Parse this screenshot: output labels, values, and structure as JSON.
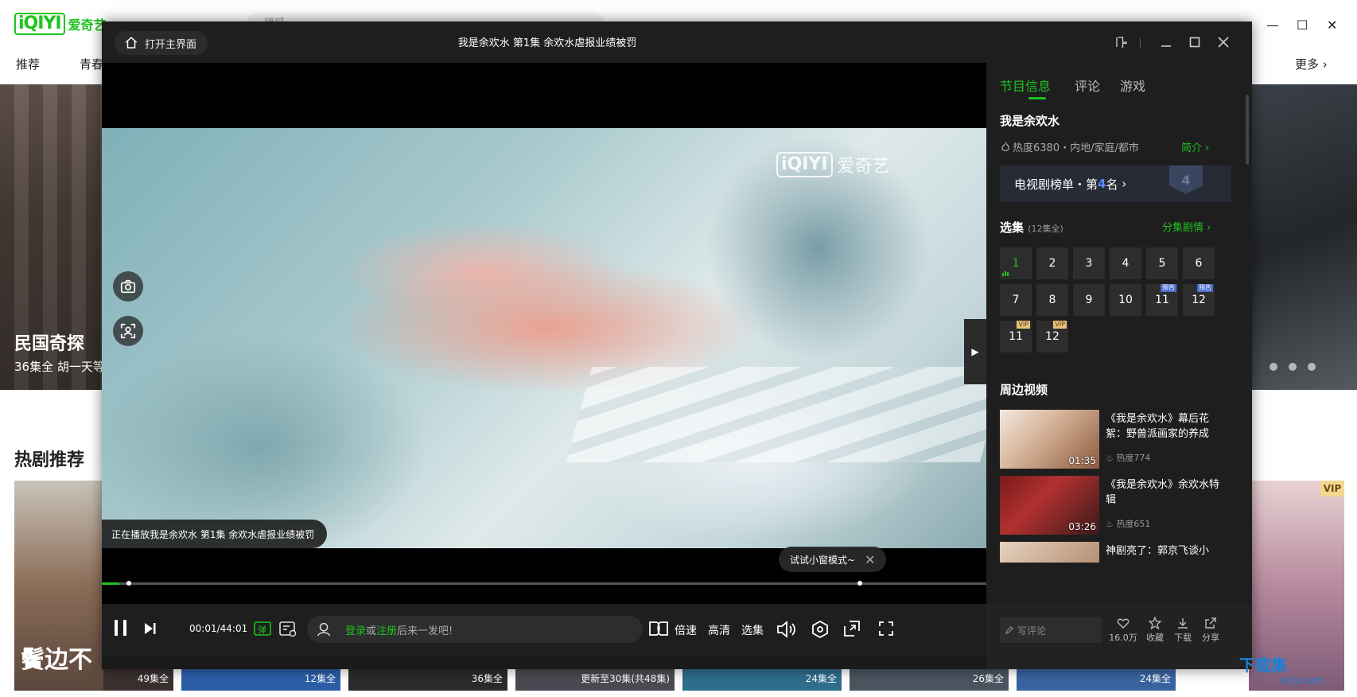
{
  "background": {
    "logo_mark": "iQIYI",
    "logo_text": "爱奇艺",
    "search_placeholder": "猎狐",
    "nav": [
      "推荐",
      "青春"
    ],
    "more": "更多",
    "banner_title": "民国奇探",
    "banner_sub": "36集全 胡一天等",
    "section_title": "热剧推荐",
    "vip_label": "VIP",
    "card_counts": [
      "49集全",
      "12集全",
      "36集全",
      "更新至30集(共48集)",
      "24集全",
      "26集全",
      "24集全"
    ],
    "card_title_hint": "鬢边不"
  },
  "player": {
    "home_label": "打开主界面",
    "title": "我是余欢水 第1集 余欢水虐报业绩被罚",
    "now_playing": "正在播放我是余欢水 第1集 余欢水虐报业绩被罚",
    "mini_tip": "试试小窗模式~",
    "time": "00:01/44:01",
    "progress": 0.0004,
    "danmaku_login": "登录",
    "danmaku_or": "或",
    "danmaku_register": "注册",
    "danmaku_rest": "后来一发吧!",
    "danmaku_toggle": "弹",
    "watermark_logo": "iQIYI",
    "watermark_text": "爱奇艺",
    "speed": "倍速",
    "quality": "高清",
    "episodes_btn": "选集",
    "accent": "#1ec31e"
  },
  "panel": {
    "tabs": [
      "节目信息",
      "评论",
      "游戏"
    ],
    "show_title": "我是余欢水",
    "show_meta": "热度6380・内地/家庭/都市",
    "intro_link": "简介",
    "rank_prefix": "电视剧榜单・第",
    "rank_num": "4",
    "rank_suffix": "名",
    "rank_badge": "4",
    "ep_title": "选集",
    "ep_sub": "(12集全)",
    "ep_plot": "分集剧情",
    "episodes": [
      {
        "label": "1",
        "active": true
      },
      {
        "label": "2"
      },
      {
        "label": "3"
      },
      {
        "label": "4"
      },
      {
        "label": "5"
      },
      {
        "label": "6"
      },
      {
        "label": "7"
      },
      {
        "label": "8"
      },
      {
        "label": "9"
      },
      {
        "label": "10"
      },
      {
        "label": "11",
        "badge": "预告"
      },
      {
        "label": "12",
        "badge": "预告"
      },
      {
        "label": "11",
        "badge": "VIP"
      },
      {
        "label": "12",
        "badge": "VIP"
      }
    ],
    "related_title": "周边视频",
    "related": [
      {
        "title": "《我是余欢水》幕后花絮：野兽派画家的养成",
        "duration": "01:35",
        "heat": "热度774"
      },
      {
        "title": "《我是余欢水》余欢水特辑",
        "duration": "03:26",
        "heat": "热度651"
      },
      {
        "title": "神剧亮了：郭京飞谈小",
        "duration": "",
        "heat": ""
      }
    ],
    "comment_placeholder": "写评论",
    "actions": [
      {
        "label": "16.0万",
        "icon": "heart-icon"
      },
      {
        "label": "收藏",
        "icon": "star-icon"
      },
      {
        "label": "下载",
        "icon": "download-icon"
      },
      {
        "label": "分享",
        "icon": "share-icon"
      }
    ]
  },
  "site_watermark": {
    "name": "下载集",
    "url": "xzjis.com"
  }
}
